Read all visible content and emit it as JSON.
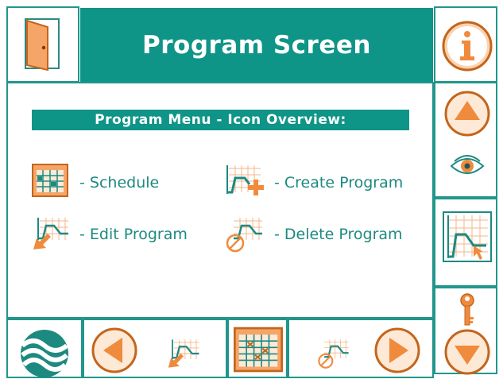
{
  "header": {
    "title": "Program Screen",
    "exit_icon": "door-exit-icon",
    "info_icon": "info-icon"
  },
  "content": {
    "menu_heading": "Program Menu - Icon Overview:",
    "items": [
      {
        "icon": "schedule-icon",
        "label": "- Schedule"
      },
      {
        "icon": "create-program-icon",
        "label": "- Create Program"
      },
      {
        "icon": "edit-program-icon",
        "label": "- Edit Program"
      },
      {
        "icon": "delete-program-icon",
        "label": "- Delete Program"
      }
    ]
  },
  "sidebar": {
    "buttons": [
      "up-arrow-icon",
      "eye-icon",
      "program-curve-icon",
      "key-icon",
      "down-arrow-icon"
    ]
  },
  "footer": {
    "buttons": [
      "logo-icon",
      "left-arrow-icon",
      "edit-program-icon",
      "schedule-icon",
      "delete-program-icon",
      "right-arrow-icon"
    ]
  },
  "colors": {
    "teal": "#0f9488",
    "border": "#21968c",
    "orange": "#f08a3c",
    "orange_dark": "#c4651c"
  }
}
